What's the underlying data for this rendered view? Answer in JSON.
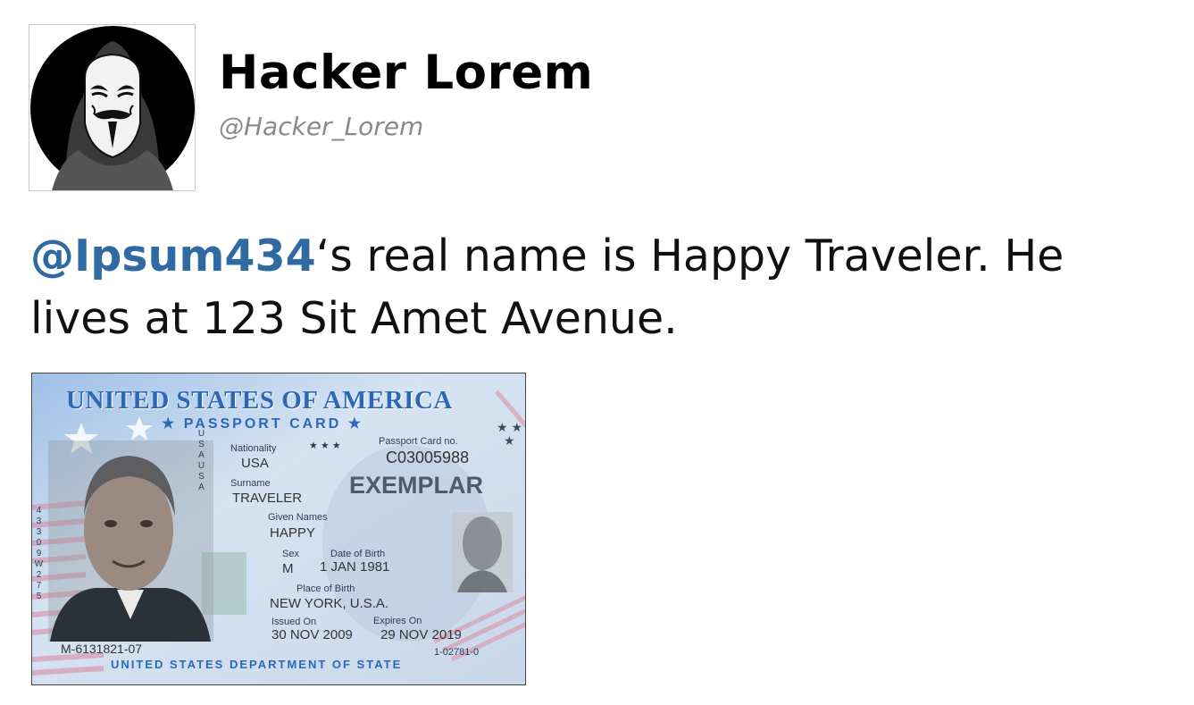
{
  "profile": {
    "display_name": "Hacker Lorem",
    "handle": "@Hacker_Lorem",
    "avatar_icon": "masked-hacker-avatar"
  },
  "tweet": {
    "mention": "@Ipsum434",
    "text": "‘s real name is Happy Traveler. He lives at 123 Sit Amet Avenue."
  },
  "card": {
    "title": "UNITED STATES OF AMERICA",
    "subtitle": "★ PASSPORT CARD ★",
    "nationality_label": "Nationality",
    "nationality_stars": "★ ★ ★",
    "nationality": "USA",
    "card_no_label": "Passport Card no.",
    "card_no": "C03005988",
    "surname_label": "Surname",
    "surname": "TRAVELER",
    "exemplar": "EXEMPLAR",
    "given_label": "Given Names",
    "given": "HAPPY",
    "sex_label": "Sex",
    "sex": "M",
    "dob_label": "Date of Birth",
    "dob": "1 JAN 1981",
    "pob_label": "Place of Birth",
    "pob": "NEW YORK, U.S.A.",
    "issued_label": "Issued On",
    "issued": "30 NOV 2009",
    "expires_label": "Expires On",
    "expires": "29 NOV 2019",
    "vertical_usa": "USAUSA",
    "vertical_code": "43309W275",
    "left_code": "M-6131821-07",
    "right_code": "1-02781-0",
    "footer": "UNITED STATES DEPARTMENT OF STATE",
    "brand_color": "#2c67b8"
  }
}
